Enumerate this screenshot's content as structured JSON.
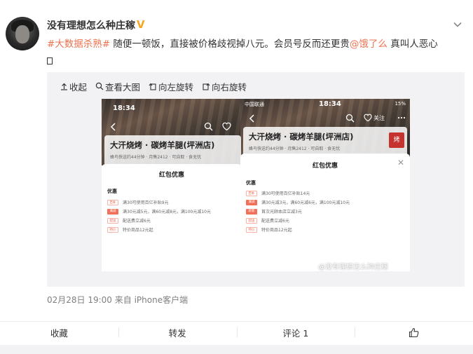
{
  "post": {
    "username": "没有理想怎么种庄稼",
    "verified_badge": "V",
    "text": {
      "hashtag": "#大数据杀熟#",
      "body": " 随便一顿饭，直接被价格歧视掉八元。会员号反而还更贵",
      "mention": "@饿了么",
      "tail": " 真叫人恶心"
    },
    "timestamp": "02月28日 19:00",
    "source": "来自 iPhone客户端"
  },
  "toolbar": {
    "collapse": "收起",
    "view_large": "查看大图",
    "rotate_left": "向左旋转",
    "rotate_right": "向右旋转"
  },
  "screenshot_left": {
    "time": "18:34",
    "shop_name": "大汗烧烤 · 碳烤羊腿(坪洲店)",
    "shop_sub": "蜂鸟快送约44分钟 · 月售2412 · 可自取 · 食无忧",
    "sheet_title": "红包优惠",
    "section_label": "优惠",
    "promos": [
      {
        "tag": "百补",
        "text": "满30可使用百亿补贴9元"
      },
      {
        "tag": "满减",
        "text": "满30元减5元，满60元减8元，满100元减10元"
      },
      {
        "tag": "配送",
        "text": "配送费立减6元"
      },
      {
        "tag": "特价",
        "text": "特价商品12元起"
      }
    ]
  },
  "screenshot_right": {
    "carrier": "中国联通",
    "time": "18:34",
    "battery": "15%",
    "follow": "关注",
    "shop_name": "大汗烧烤 · 碳烤羊腿(坪洲店)",
    "shop_sub": "蜂鸟快送约44分钟 · 月售2412 · 可自取 · 食无忧",
    "sheet_title": "红包优惠",
    "section_label": "优惠",
    "promos": [
      {
        "tag": "百补",
        "text": "满30可使用百亿补贴14元"
      },
      {
        "tag": "满减",
        "text": "满30元减3元，满60元减6元，满100元减10元"
      },
      {
        "tag": "新客",
        "text": "首次光顾本店立减3元"
      },
      {
        "tag": "配送",
        "text": "配送费立减6元"
      },
      {
        "tag": "特价",
        "text": "特价商品12元起"
      }
    ]
  },
  "watermark": "@没有理想怎么种庄稼",
  "actions": {
    "favorite": "收藏",
    "repost": "转发",
    "comment": "评论 1"
  },
  "colors": {
    "accent": "#eb7350",
    "badge": "#f5a623",
    "muted": "#808080"
  }
}
